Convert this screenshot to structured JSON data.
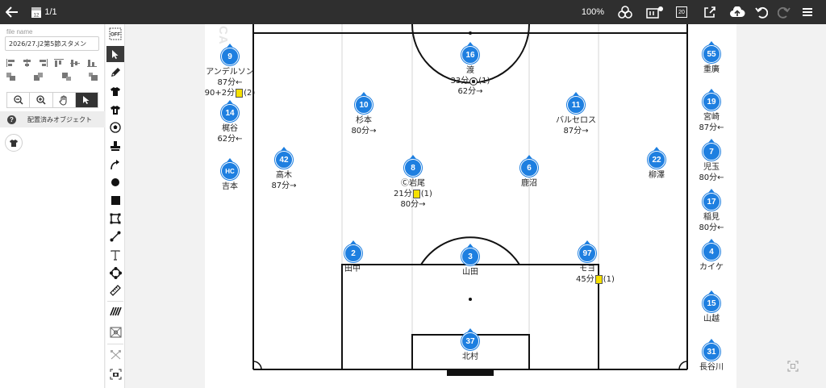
{
  "topbar": {
    "page_counter": "1/1",
    "calendar_number": "12",
    "zoom_level": "100%",
    "size_badge": "20"
  },
  "sidebar": {
    "file_name_label": "file name",
    "file_name_value": "2026/27.J2第5節スタメン",
    "placed_objects_label": "配置済みオブジェクト"
  },
  "field": {
    "watermark": "CA"
  },
  "players": {
    "p16": {
      "number": "16",
      "name": "渡",
      "line1": {
        "text": "33分",
        "ball": true,
        "suffix": "(1)"
      },
      "line2": "62分→"
    },
    "p10": {
      "number": "10",
      "name": "杉本",
      "line1": {
        "text": "80分→"
      }
    },
    "p11": {
      "number": "11",
      "name": "バルセロス",
      "line1": {
        "text": "87分→"
      }
    },
    "p42": {
      "number": "42",
      "name": "高木",
      "line1": {
        "text": "87分→"
      }
    },
    "p8": {
      "number": "8",
      "name": "Ⓒ岩尾",
      "line1": {
        "text": "21分",
        "card": true,
        "suffix": "(1)"
      },
      "line2": "80分→"
    },
    "p6": {
      "number": "6",
      "name": "鹿沼"
    },
    "p22": {
      "number": "22",
      "name": "柳澤"
    },
    "p2": {
      "number": "2",
      "name": "田中"
    },
    "p3": {
      "number": "3",
      "name": "山田"
    },
    "p97": {
      "number": "97",
      "name": "モヨ",
      "line1": {
        "text": "45分",
        "card": true,
        "suffix": "(1)"
      }
    },
    "p37": {
      "number": "37",
      "name": "北村"
    }
  },
  "bench_left": {
    "b9": {
      "number": "9",
      "name": "アンデルソン",
      "line1": {
        "text": "87分←"
      },
      "line2": "90+2分",
      "line2_card": true,
      "line2_suffix": "(2)"
    },
    "b14": {
      "number": "14",
      "name": "梶谷",
      "line1": {
        "text": "62分←"
      }
    },
    "bHC": {
      "number": "HC",
      "name": "吉本"
    }
  },
  "bench_right": {
    "r55": {
      "number": "55",
      "name": "重廣"
    },
    "r19": {
      "number": "19",
      "name": "宮崎",
      "line1": {
        "text": "87分←"
      }
    },
    "r7": {
      "number": "7",
      "name": "児玉",
      "line1": {
        "text": "80分←"
      }
    },
    "r17": {
      "number": "17",
      "name": "稲見",
      "line1": {
        "text": "80分←"
      }
    },
    "r4": {
      "number": "4",
      "name": "カイケ"
    },
    "r15": {
      "number": "15",
      "name": "山越"
    },
    "r31": {
      "number": "31",
      "name": "長谷川"
    }
  },
  "colors": {
    "topbar": "#2f2f2f",
    "badge": "#1e7fe0",
    "yellow_card": "#f5e000"
  }
}
